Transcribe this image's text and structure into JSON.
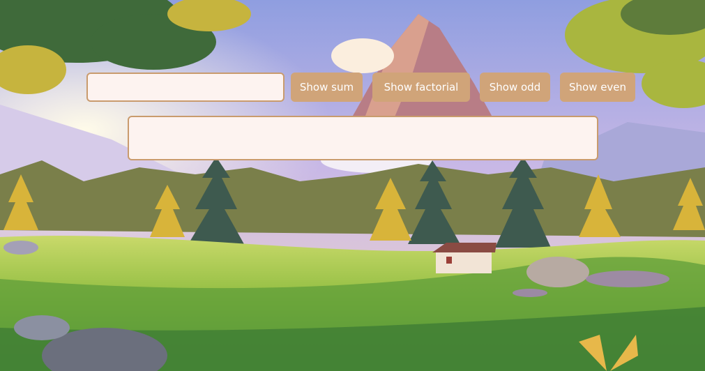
{
  "controls": {
    "number_input": {
      "value": ""
    },
    "buttons": {
      "sum": "Show sum",
      "factorial": "Show factorial",
      "odd": "Show odd",
      "even": "Show even"
    },
    "output_box": {
      "text": ""
    }
  },
  "colors": {
    "button_bg": "#d0a479",
    "button_text": "#ffffff",
    "field_bg": "#fdf3f0",
    "field_border": "#c99b6d"
  }
}
